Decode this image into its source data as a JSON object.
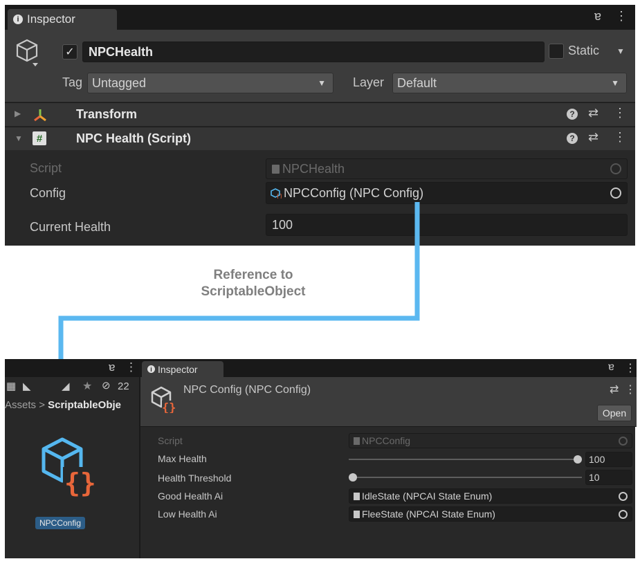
{
  "top_inspector": {
    "tab_label": "Inspector",
    "object": {
      "name": "NPCHealth",
      "enabled": true,
      "static_label": "Static"
    },
    "tag": {
      "label": "Tag",
      "value": "Untagged"
    },
    "layer": {
      "label": "Layer",
      "value": "Default"
    },
    "components": [
      {
        "name": "Transform",
        "collapsed": true
      },
      {
        "name": "NPC Health (Script)",
        "collapsed": false
      }
    ],
    "fields": {
      "script": {
        "label": "Script",
        "value": "NPCHealth"
      },
      "config": {
        "label": "Config",
        "value": "NPCConfig (NPC Config)"
      },
      "current_health": {
        "label": "Current Health",
        "value": "100"
      }
    }
  },
  "annotation": {
    "line1": "Reference to",
    "line2": "ScriptableObject",
    "color": "#5bb8f0"
  },
  "project_panel": {
    "hidden_count": "22",
    "breadcrumb": {
      "root": "Assets",
      "separator": ">",
      "folder": "ScriptableObje"
    },
    "asset": {
      "name": "NPCConfig"
    }
  },
  "bottom_inspector": {
    "tab_label": "Inspector",
    "title": "NPC Config (NPC Config)",
    "open_button": "Open",
    "fields": {
      "script": {
        "label": "Script",
        "value": "NPCConfig"
      },
      "max_health": {
        "label": "Max Health",
        "value": "100",
        "slider_fraction": 1.0
      },
      "health_threshold": {
        "label": "Health Threshold",
        "value": "10",
        "slider_fraction": 0.0
      },
      "good_health_ai": {
        "label": "Good Health Ai",
        "value": "IdleState (NPCAI State Enum)"
      },
      "low_health_ai": {
        "label": "Low Health Ai",
        "value": "FleeState (NPCAI State Enum)"
      }
    }
  },
  "colors": {
    "panel": "#282828",
    "accent_arrow": "#5bb8f0",
    "asset_orange": "#e8663a",
    "asset_blue": "#55b7ef"
  }
}
